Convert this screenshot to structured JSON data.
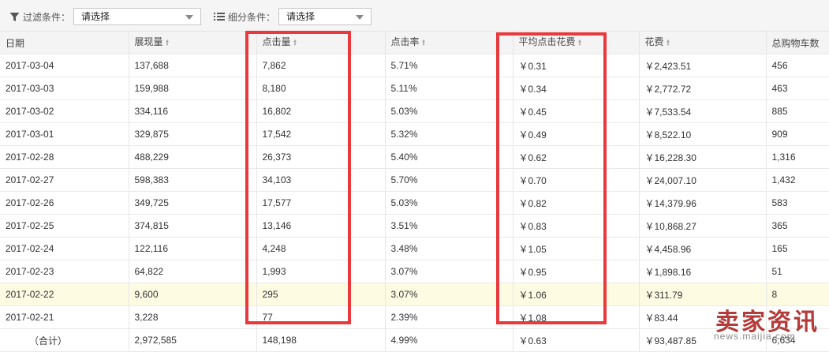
{
  "toolbar": {
    "filter_label": "过滤条件：",
    "filter_value": "请选择",
    "segment_label": "细分条件：",
    "segment_value": "请选择"
  },
  "table": {
    "columns": [
      "日期",
      "展现量",
      "点击量",
      "点击率",
      "平均点击花费",
      "花费",
      "总购物车数"
    ],
    "rows": [
      [
        "2017-03-04",
        "137,688",
        "7,862",
        "5.71%",
        "￥0.31",
        "￥2,423.51",
        "456"
      ],
      [
        "2017-03-03",
        "159,988",
        "8,180",
        "5.11%",
        "￥0.34",
        "￥2,772.72",
        "463"
      ],
      [
        "2017-03-02",
        "334,116",
        "16,802",
        "5.03%",
        "￥0.45",
        "￥7,533.54",
        "885"
      ],
      [
        "2017-03-01",
        "329,875",
        "17,542",
        "5.32%",
        "￥0.49",
        "￥8,522.10",
        "909"
      ],
      [
        "2017-02-28",
        "488,229",
        "26,373",
        "5.40%",
        "￥0.62",
        "￥16,228.30",
        "1,316"
      ],
      [
        "2017-02-27",
        "598,383",
        "34,103",
        "5.70%",
        "￥0.70",
        "￥24,007.10",
        "1,432"
      ],
      [
        "2017-02-26",
        "349,725",
        "17,577",
        "5.03%",
        "￥0.82",
        "￥14,379.96",
        "583"
      ],
      [
        "2017-02-25",
        "374,815",
        "13,146",
        "3.51%",
        "￥0.83",
        "￥10,868.27",
        "365"
      ],
      [
        "2017-02-24",
        "122,116",
        "4,248",
        "3.48%",
        "￥1.05",
        "￥4,458.96",
        "165"
      ],
      [
        "2017-02-23",
        "64,822",
        "1,993",
        "3.07%",
        "￥0.95",
        "￥1,898.16",
        "51"
      ],
      [
        "2017-02-22",
        "9,600",
        "295",
        "3.07%",
        "￥1.06",
        "￥311.79",
        "8"
      ],
      [
        "2017-02-21",
        "3,228",
        "77",
        "2.39%",
        "￥1.08",
        "￥83.44",
        ""
      ]
    ],
    "highlighted_row": 10,
    "total": [
      "（合计）",
      "2,972,585",
      "148,198",
      "4.99%",
      "￥0.63",
      "￥93,487.85",
      "6,634"
    ]
  },
  "watermark": {
    "brand": "卖家资讯",
    "url": "news.maijia.com"
  },
  "colors": {
    "annotation_red": "#e8393c",
    "highlight_row": "#fefbe3",
    "header_bg": "#f4f4f4"
  }
}
